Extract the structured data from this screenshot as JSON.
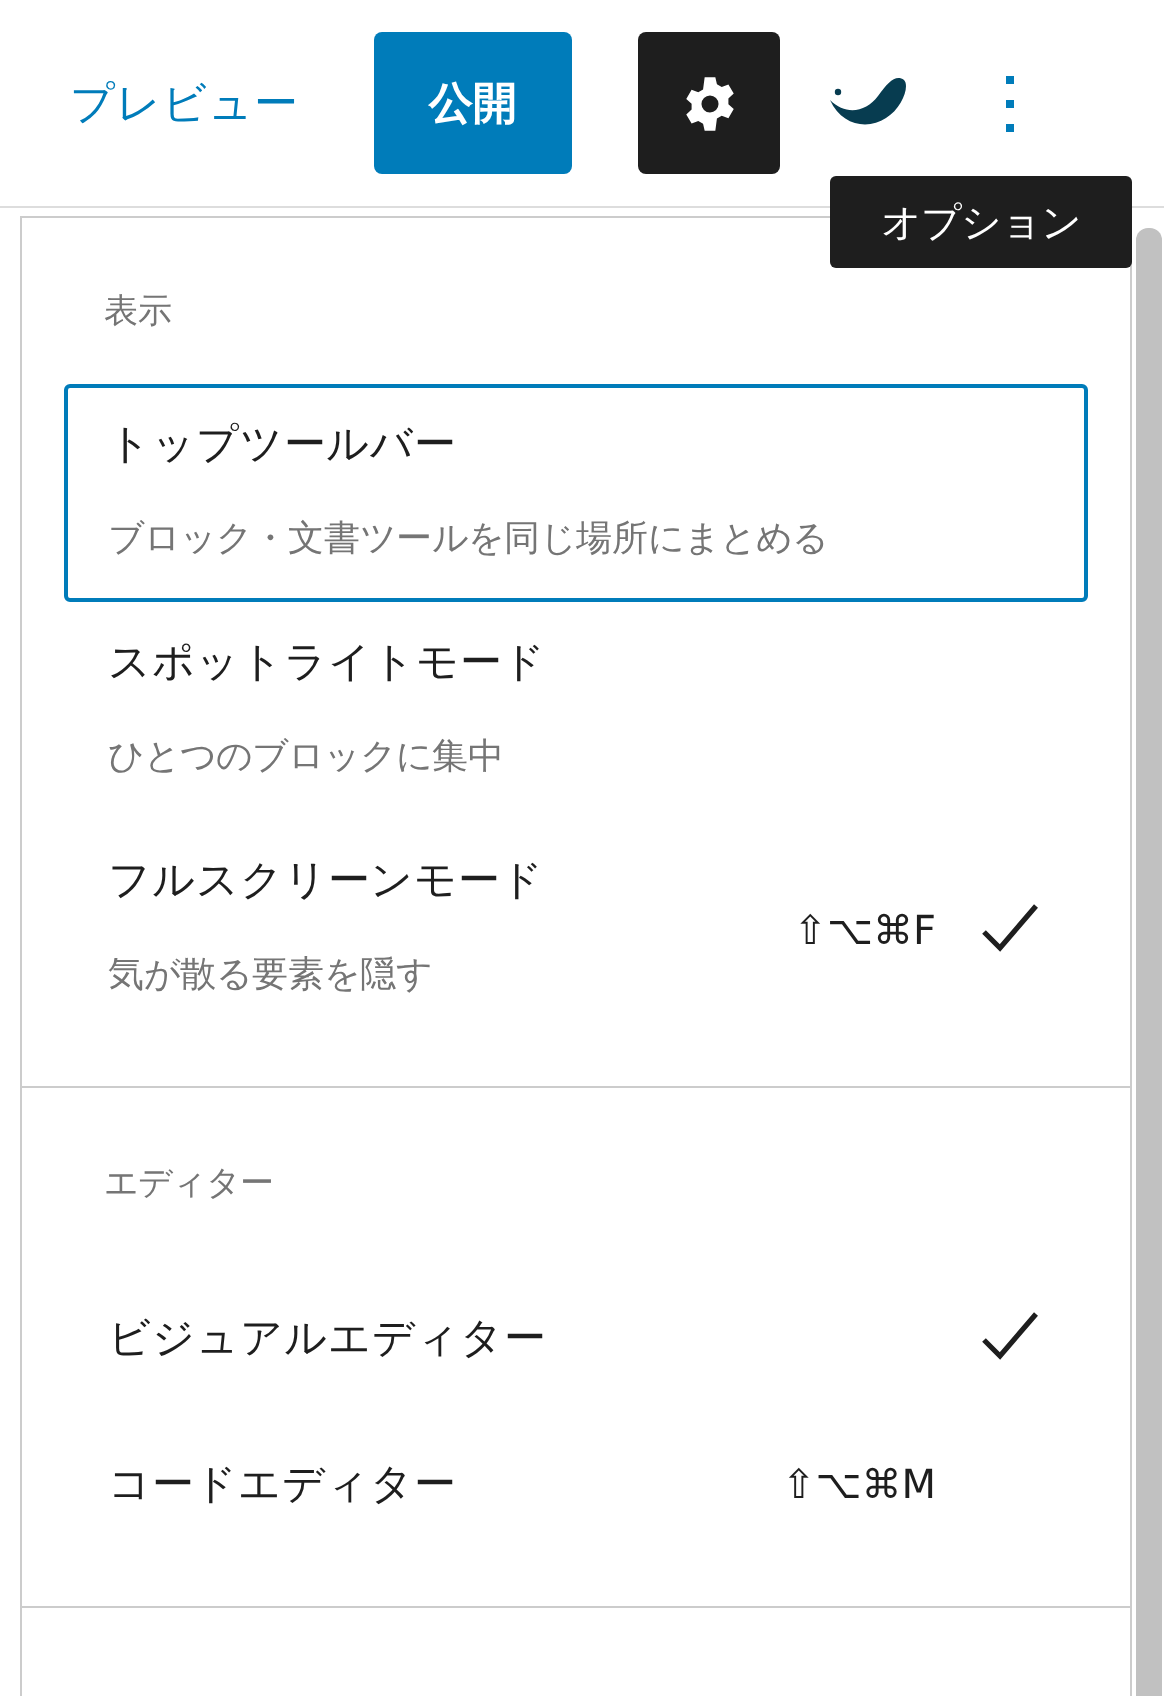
{
  "toolbar": {
    "preview": "プレビュー",
    "publish": "公開",
    "settings": {
      "selected": true
    }
  },
  "tooltip": "オプション",
  "menu": {
    "sections": [
      {
        "label": "表示",
        "items": [
          {
            "title": "トップツールバー",
            "description": "ブロック・文書ツールを同じ場所にまとめる",
            "checked": false,
            "focused": true
          },
          {
            "title": "スポットライトモード",
            "description": "ひとつのブロックに集中",
            "checked": false,
            "focused": false
          },
          {
            "title": "フルスクリーンモード",
            "description": "気が散る要素を隠す",
            "shortcut": "⇧⌥⌘F",
            "checked": true,
            "focused": false
          }
        ]
      },
      {
        "label": "エディター",
        "items": [
          {
            "title": "ビジュアルエディター",
            "checked": true,
            "focused": false
          },
          {
            "title": "コードエディター",
            "shortcut": "⇧⌥⌘M",
            "checked": false,
            "focused": false
          }
        ]
      }
    ]
  }
}
